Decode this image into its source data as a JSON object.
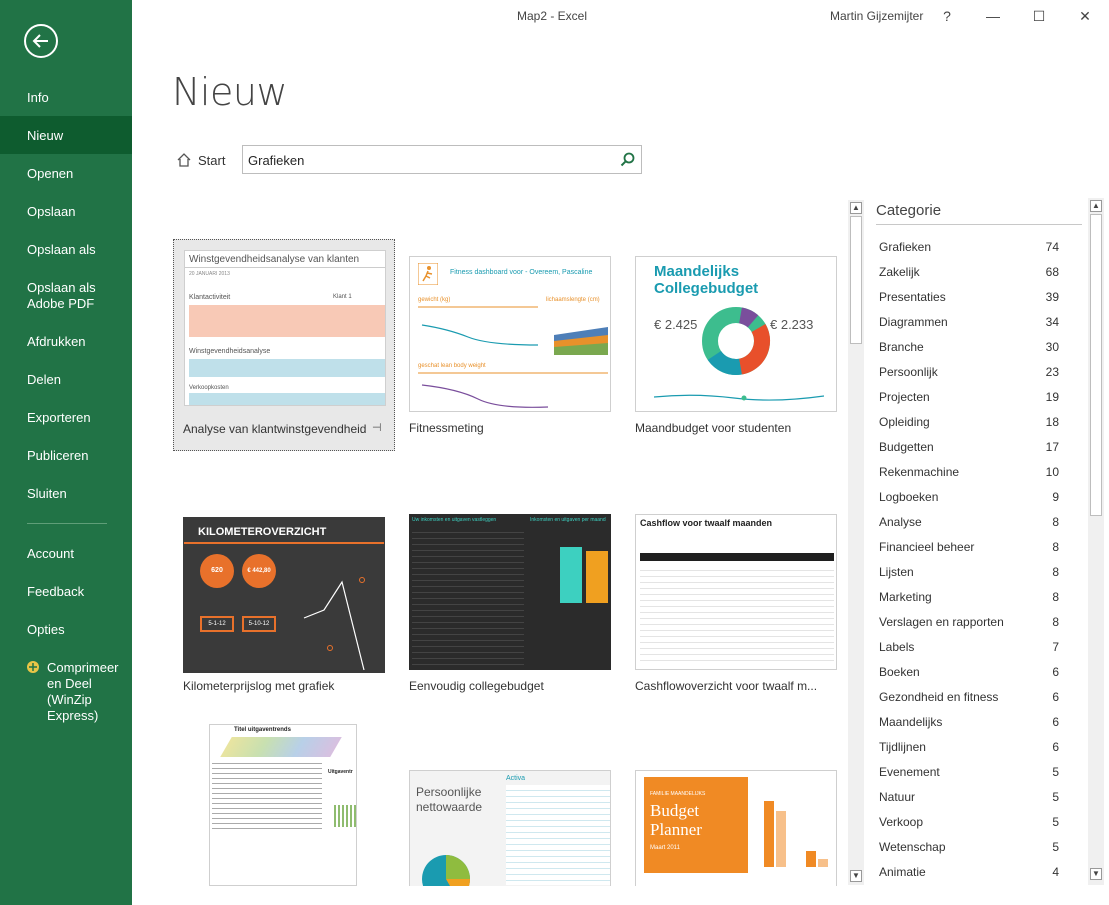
{
  "window": {
    "title": "Map2  -  Excel",
    "user": "Martin Gijzemijter",
    "help": "?",
    "minimize": "—",
    "maximize": "☐",
    "close": "✕"
  },
  "sidebar": {
    "items": [
      {
        "label": "Info"
      },
      {
        "label": "Nieuw"
      },
      {
        "label": "Openen"
      },
      {
        "label": "Opslaan"
      },
      {
        "label": "Opslaan als"
      },
      {
        "label": "Opslaan als\nAdobe PDF"
      },
      {
        "label": "Afdrukken"
      },
      {
        "label": "Delen"
      },
      {
        "label": "Exporteren"
      },
      {
        "label": "Publiceren"
      },
      {
        "label": "Sluiten"
      },
      {
        "label": "Account"
      },
      {
        "label": "Feedback"
      },
      {
        "label": "Opties"
      },
      {
        "label": "Comprimeer\nen Deel\n(WinZip\nExpress)"
      }
    ]
  },
  "main": {
    "title": "Nieuw",
    "start_label": "Start",
    "search_value": "Grafieken"
  },
  "templates": [
    {
      "label": "Analyse van klantwinstgevendheid",
      "thumb_title": "Winstgevendheidsanalyse van klanten",
      "thumb_date": "20 JANUARI 2013",
      "thumb_section1": "Klantactiviteit",
      "thumb_col": "Klant 1",
      "thumb_section2": "Winstgevendheidsanalyse",
      "thumb_section3": "Verkoopkosten"
    },
    {
      "label": "Fitnessmeting",
      "thumb_title": "Fitness dashboard voor - Overeem, Pascaline",
      "thumb_a": "gewicht (kg)",
      "thumb_b": "lichaamslengte (cm)",
      "thumb_c": "geschat lean body weight"
    },
    {
      "label": "Maandbudget voor studenten",
      "thumb_title": "Maandelijks Collegebudget",
      "thumb_in": "€ 2.425",
      "thumb_out": "€ 2.233"
    },
    {
      "label": "Kilometerprijslog met grafiek",
      "thumb_title": "KILOMETEROVERZICHT",
      "thumb_v1": "620",
      "thumb_v2": "€ 442,80",
      "thumb_v3": "5-1-12",
      "thumb_v4": "5-10-12"
    },
    {
      "label": "Eenvoudig collegebudget",
      "thumb_title": "Uw inkomsten en uitgaven vastleggen",
      "thumb_chart": "Inkomsten en uitgaven per maand"
    },
    {
      "label": "Cashflowoverzicht voor twaalf m...",
      "thumb_title": "Cashflow voor twaalf maanden"
    },
    {
      "label": "",
      "thumb_title": "Titel uitgaventrends"
    },
    {
      "label": "",
      "thumb_title": "Persoonlijke nettowaarde",
      "thumb_sub": "Activa"
    },
    {
      "label": "",
      "thumb_title": "Budget Planner",
      "thumb_sub": "FAMILIE MAANDELIJKS",
      "thumb_date": "Maart 2011"
    }
  ],
  "categories": {
    "title": "Categorie",
    "items": [
      {
        "name": "Grafieken",
        "count": "74"
      },
      {
        "name": "Zakelijk",
        "count": "68"
      },
      {
        "name": "Presentaties",
        "count": "39"
      },
      {
        "name": "Diagrammen",
        "count": "34"
      },
      {
        "name": "Branche",
        "count": "30"
      },
      {
        "name": "Persoonlijk",
        "count": "23"
      },
      {
        "name": "Projecten",
        "count": "19"
      },
      {
        "name": "Opleiding",
        "count": "18"
      },
      {
        "name": "Budgetten",
        "count": "17"
      },
      {
        "name": "Rekenmachine",
        "count": "10"
      },
      {
        "name": "Logboeken",
        "count": "9"
      },
      {
        "name": "Analyse",
        "count": "8"
      },
      {
        "name": "Financieel beheer",
        "count": "8"
      },
      {
        "name": "Lijsten",
        "count": "8"
      },
      {
        "name": "Marketing",
        "count": "8"
      },
      {
        "name": "Verslagen en rapporten",
        "count": "8"
      },
      {
        "name": "Labels",
        "count": "7"
      },
      {
        "name": "Boeken",
        "count": "6"
      },
      {
        "name": "Gezondheid en fitness",
        "count": "6"
      },
      {
        "name": "Maandelijks",
        "count": "6"
      },
      {
        "name": "Tijdlijnen",
        "count": "6"
      },
      {
        "name": "Evenement",
        "count": "5"
      },
      {
        "name": "Natuur",
        "count": "5"
      },
      {
        "name": "Verkoop",
        "count": "5"
      },
      {
        "name": "Wetenschap",
        "count": "5"
      },
      {
        "name": "Animatie",
        "count": "4"
      }
    ]
  },
  "colors": {
    "sidebar_bg": "#217346",
    "sidebar_active": "#0e5c2f",
    "accent": "#217346"
  }
}
